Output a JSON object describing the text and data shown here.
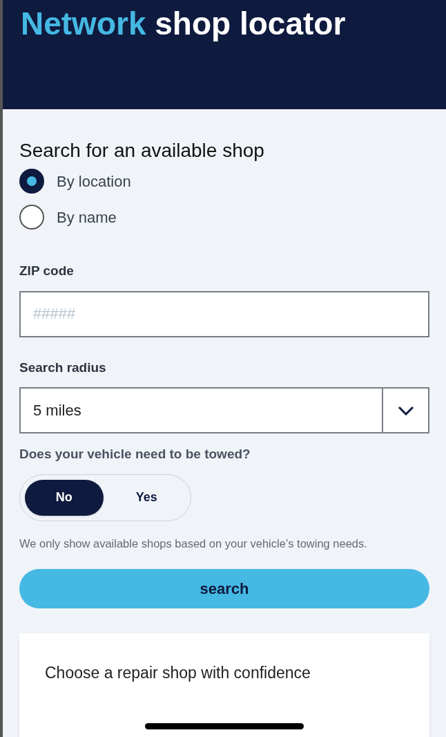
{
  "header": {
    "title_highlight": "Network",
    "title_rest": "shop locator"
  },
  "form": {
    "heading": "Search for an available shop",
    "search_by": [
      {
        "label": "By location",
        "selected": true
      },
      {
        "label": "By name",
        "selected": false
      }
    ],
    "zip": {
      "label": "ZIP code",
      "placeholder": "#####"
    },
    "radius": {
      "label": "Search radius",
      "value": "5 miles"
    },
    "towing": {
      "question": "Does your vehicle need to be towed?",
      "options": [
        {
          "label": "No",
          "selected": true
        },
        {
          "label": "Yes",
          "selected": false
        }
      ],
      "help": "We only show available shops based on your vehicle’s towing needs."
    },
    "search_button": "search"
  },
  "card": {
    "title": "Choose a repair shop with confidence"
  }
}
